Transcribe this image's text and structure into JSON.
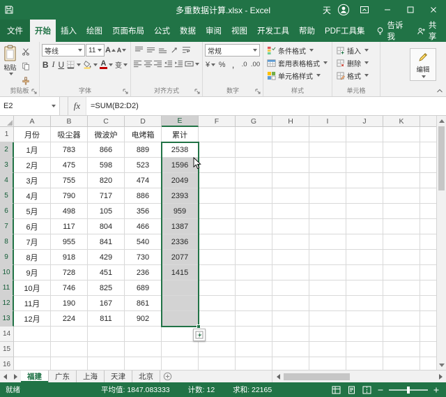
{
  "title_bar": {
    "title": "多重数据计算.xlsx - Excel",
    "user_initial": "天"
  },
  "ribbon": {
    "tabs": [
      {
        "label": "文件",
        "type": "file"
      },
      {
        "label": "开始",
        "active": true
      },
      {
        "label": "插入"
      },
      {
        "label": "绘图"
      },
      {
        "label": "页面布局"
      },
      {
        "label": "公式"
      },
      {
        "label": "数据"
      },
      {
        "label": "审阅"
      },
      {
        "label": "视图"
      },
      {
        "label": "开发工具"
      },
      {
        "label": "帮助"
      },
      {
        "label": "PDF工具集"
      }
    ],
    "tell_me": "告诉我",
    "share": "共享",
    "clipboard": {
      "label": "剪贴板",
      "paste": "粘贴"
    },
    "font": {
      "label": "字体",
      "name": "等线",
      "size": "11",
      "glyphs": {
        "bold": "B",
        "italic": "I",
        "underline": "U",
        "color": "A",
        "grow": "A",
        "shrink": "A",
        "phonetic": "变"
      }
    },
    "alignment": {
      "label": "对齐方式"
    },
    "number": {
      "label": "数字",
      "format": "常规",
      "glyphs": {
        "currency": "¥",
        "percent": "%",
        "comma": ",",
        "inc_decimal": ".0",
        "dec_decimal": ".00"
      }
    },
    "styles": {
      "label": "样式",
      "items": [
        "条件格式",
        "套用表格格式",
        "单元格样式"
      ]
    },
    "cells": {
      "label": "单元格",
      "items": [
        "插入",
        "删除",
        "格式"
      ]
    },
    "editing": {
      "label": "编辑"
    }
  },
  "formula_bar": {
    "name_box": "E2",
    "fx": "fx",
    "formula": "=SUM(B2:D2)"
  },
  "grid": {
    "column_letters": [
      "A",
      "B",
      "C",
      "D",
      "E",
      "F",
      "G",
      "H",
      "I",
      "J",
      "K"
    ],
    "visible_row_count": 16,
    "rows": [
      [
        "月份",
        "吸尘器",
        "微波炉",
        "电烤箱",
        "累计"
      ],
      [
        "1月",
        "783",
        "866",
        "889",
        "2538"
      ],
      [
        "2月",
        "475",
        "598",
        "523",
        "1596"
      ],
      [
        "3月",
        "755",
        "820",
        "474",
        "2049"
      ],
      [
        "4月",
        "790",
        "717",
        "886",
        "2393"
      ],
      [
        "5月",
        "498",
        "105",
        "356",
        "959"
      ],
      [
        "6月",
        "117",
        "804",
        "466",
        "1387"
      ],
      [
        "7月",
        "955",
        "841",
        "540",
        "2336"
      ],
      [
        "8月",
        "918",
        "429",
        "730",
        "2077"
      ],
      [
        "9月",
        "728",
        "451",
        "236",
        "1415"
      ],
      [
        "10月",
        "746",
        "825",
        "689",
        ""
      ],
      [
        "11月",
        "190",
        "167",
        "861",
        ""
      ],
      [
        "12月",
        "224",
        "811",
        "902",
        ""
      ]
    ],
    "selection": {
      "range": "E2:E13",
      "active_cell": "E2",
      "col_index": 4,
      "row_start": 2,
      "row_end": 13
    }
  },
  "sheet_tabs": {
    "tabs": [
      {
        "label": "福建",
        "active": true
      },
      {
        "label": "广东"
      },
      {
        "label": "上海"
      },
      {
        "label": "天津"
      },
      {
        "label": "北京"
      }
    ]
  },
  "status_bar": {
    "mode": "就绪",
    "stats": [
      "平均值: 1847.083333",
      "计数: 12",
      "求和: 22165"
    ]
  },
  "colors": {
    "excel_green": "#217346",
    "ribbon_bg": "#f1f1f1",
    "selection_fill": "#d3d3d3",
    "selection_border": "#217346",
    "gridline": "#d9d9d9",
    "font_color_bar": "#c00000"
  }
}
